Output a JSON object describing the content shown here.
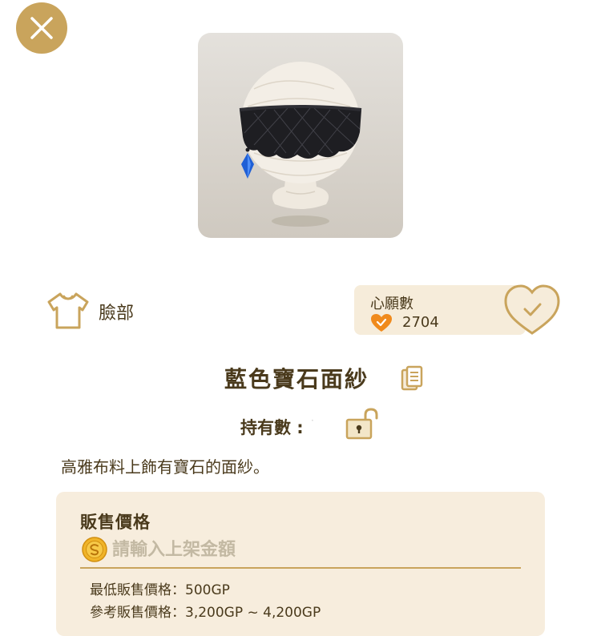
{
  "close": {
    "icon": "close-icon"
  },
  "item": {
    "category_icon": "shirt-icon",
    "category": "臉部",
    "name": "藍色寶石面紗",
    "copy_icon": "copy-icon",
    "owned_label": "持有數 :",
    "owned_value": "·",
    "lock_icon": "unlocked-padlock-icon",
    "description": "高雅布料上飾有寶石的面紗。"
  },
  "wishlist": {
    "title": "心願數",
    "count": "2704",
    "heart_icon": "heart-icon",
    "button_icon": "heart-check-icon"
  },
  "price": {
    "title": "販售價格",
    "coin_icon": "coin-icon",
    "input_placeholder": "請輸入上架金額",
    "input_value": "",
    "min_price": "最低販售價格：500GP",
    "ref_price": "參考販售價格：3,200GP ~ 4,200GP"
  },
  "colors": {
    "accent_gold": "#c9a45c",
    "text_brown": "#4a3a1c",
    "panel_cream": "#f7eddd",
    "heart_orange": "#f08a1c"
  }
}
